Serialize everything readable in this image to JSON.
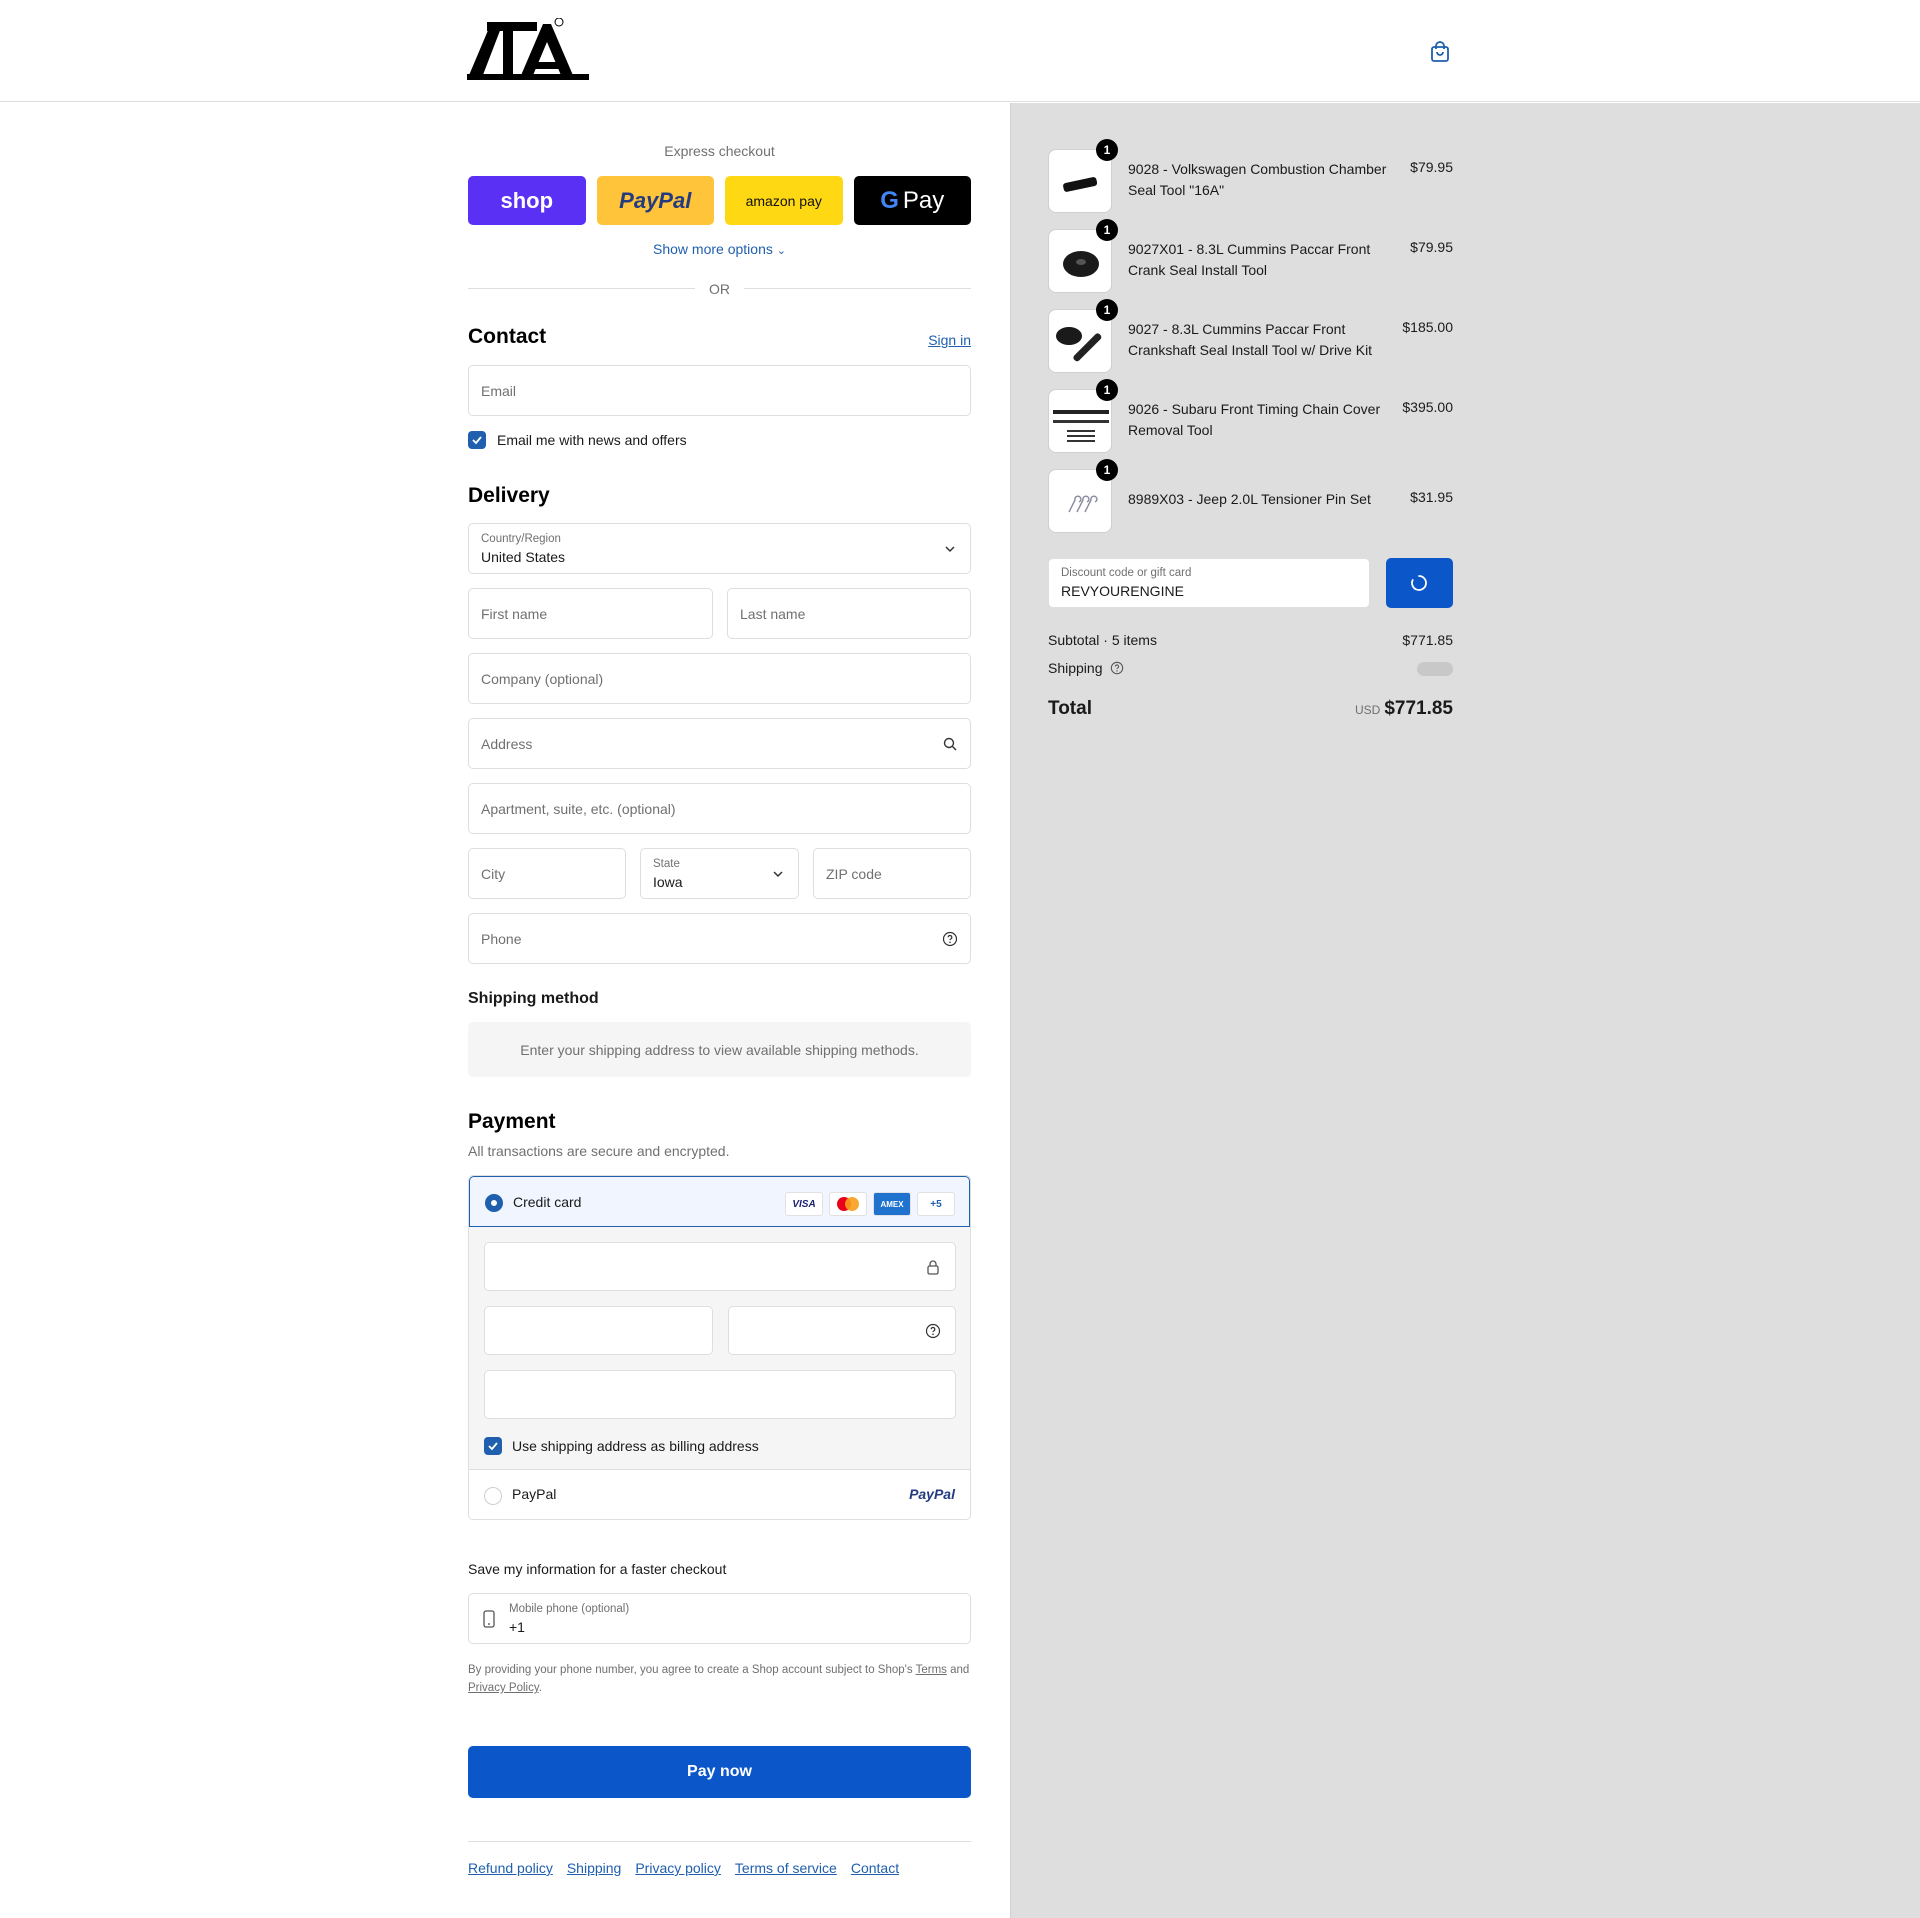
{
  "brand": {
    "logo_text": "CTA",
    "colors": {
      "accent": "#1f5fae",
      "pay_button": "#0b56c9",
      "shop": "#5a31f4",
      "paypal": "#ffc439",
      "amazon": "#ffd814"
    }
  },
  "express": {
    "title": "Express checkout",
    "shop_label": "shop",
    "paypal_label": "PayPal",
    "amazon_label": "amazon pay",
    "gpay_label": "Pay",
    "more_options": "Show more options",
    "or": "OR"
  },
  "contact": {
    "heading": "Contact",
    "sign_in": "Sign in",
    "email_placeholder": "Email",
    "newsletter_label": "Email me with news and offers"
  },
  "delivery": {
    "heading": "Delivery",
    "country_label": "Country/Region",
    "country_value": "United States",
    "first_name": "First name",
    "last_name": "Last name",
    "company": "Company (optional)",
    "address": "Address",
    "apartment": "Apartment, suite, etc. (optional)",
    "city": "City",
    "state_label": "State",
    "state_value": "Iowa",
    "zip": "ZIP code",
    "phone": "Phone"
  },
  "shipping_method": {
    "heading": "Shipping method",
    "message": "Enter your shipping address to view available shipping methods."
  },
  "payment": {
    "heading": "Payment",
    "subtitle": "All transactions are secure and encrypted.",
    "credit_card_label": "Credit card",
    "card_badges": [
      "VISA",
      "MC",
      "AMEX",
      "+5"
    ],
    "billing_same_label": "Use shipping address as billing address",
    "paypal_label": "PayPal",
    "paypal_logo": "PayPal"
  },
  "save_info": {
    "heading": "Save my information for a faster checkout",
    "mobile_label": "Mobile phone (optional)",
    "mobile_value": "+1",
    "disclaimer_prefix": "By providing your phone number, you agree to create a Shop account subject to Shop's",
    "terms": "Terms",
    "and": "and",
    "privacy": "Privacy Policy",
    "period": "."
  },
  "pay_now": "Pay now",
  "footer": {
    "links": [
      "Refund policy",
      "Shipping",
      "Privacy policy",
      "Terms of service",
      "Contact"
    ]
  },
  "order": {
    "items": [
      {
        "qty": "1",
        "name": "9028 - Volkswagen Combustion Chamber Seal Tool \"16A\"",
        "price": "$79.95"
      },
      {
        "qty": "1",
        "name": "9027X01 - 8.3L Cummins Paccar Front Crank Seal Install Tool",
        "price": "$79.95"
      },
      {
        "qty": "1",
        "name": "9027 - 8.3L Cummins Paccar Front Crankshaft Seal Install Tool w/ Drive Kit",
        "price": "$185.00"
      },
      {
        "qty": "1",
        "name": "9026 - Subaru Front Timing Chain Cover Removal Tool",
        "price": "$395.00"
      },
      {
        "qty": "1",
        "name": "8989X03 - Jeep 2.0L Tensioner Pin Set",
        "price": "$31.95"
      }
    ],
    "discount_label": "Discount code or gift card",
    "discount_value": "REVYOURENGINE",
    "subtotal_label": "Subtotal · 5 items",
    "subtotal_value": "$771.85",
    "shipping_label": "Shipping",
    "total_label": "Total",
    "currency": "USD",
    "total_value": "$771.85"
  }
}
